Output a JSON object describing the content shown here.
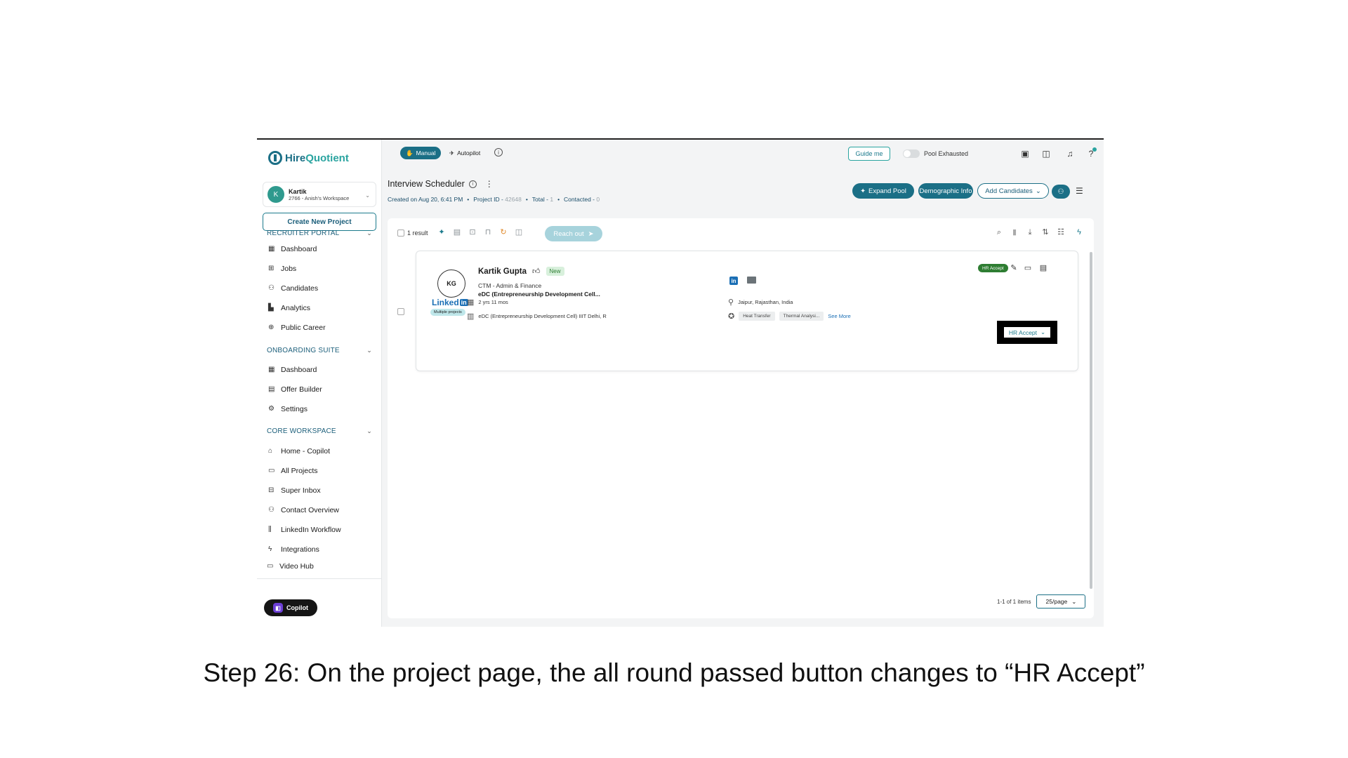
{
  "caption": "Step 26:  On the project page, the all round passed button changes to “HR Accept”",
  "brand": {
    "name_a": "Hire",
    "name_b": "Quotient"
  },
  "user": {
    "initial": "K",
    "name": "Kartik",
    "workspace": "2766 - Anish's Workspace"
  },
  "sidebar": {
    "create_label": "Create New Project",
    "sections": [
      {
        "title": "RECRUITER PORTAL",
        "items": [
          "Dashboard",
          "Jobs",
          "Candidates",
          "Analytics",
          "Public Career"
        ]
      },
      {
        "title": "ONBOARDING SUITE",
        "items": [
          "Dashboard",
          "Offer Builder",
          "Settings"
        ]
      },
      {
        "title": "CORE WORKSPACE",
        "items": [
          "Home - Copilot",
          "All Projects",
          "Super Inbox",
          "Contact Overview",
          "LinkedIn Workflow",
          "Integrations"
        ]
      }
    ],
    "video_hub": "Video Hub",
    "copilot": "Copilot"
  },
  "topbar": {
    "manual": "Manual",
    "autopilot": "Autopilot",
    "guide": "Guide me",
    "pool_label": "Pool Exhausted",
    "avatar": "K"
  },
  "project": {
    "title": "Interview Scheduler",
    "created_prefix": "Created on",
    "created_value": "Aug 20, 6:41 PM",
    "project_id_label": "Project ID -",
    "project_id_value": "42648",
    "total_label": "Total -",
    "total_value": "1",
    "contacted_label": "Contacted -",
    "contacted_value": "0",
    "expand_pool": "Expand Pool",
    "demographic": "Demographic Info",
    "add_candidates": "Add Candidates"
  },
  "toolbar": {
    "result_label": "1 result",
    "reach_out": "Reach out"
  },
  "candidate": {
    "initials": "KG",
    "name": "Kartik Gupta",
    "status_badge": "New",
    "role": "CTM - Admin & Finance",
    "org": "eDC (Entrepreneurship Development Cell...",
    "linkedin_text": "Linked",
    "linkedin_in": "in",
    "multi_projects": "Multiple projects",
    "experience": "2 yrs 11 mos",
    "education": "eDC (Entrepreneurship Development Cell) IIIT Delhi, R",
    "location": "Jaipur, Rajasthan, India",
    "skills": [
      "Heat Transfer",
      "Thermal Analysi..."
    ],
    "see_more": "See More",
    "stage_badge": "HR Accept",
    "stage_select": "HR Accept"
  },
  "pagination": {
    "range": "1-1 of 1 items",
    "per_page": "25/page"
  },
  "colors": {
    "primary": "#1b6f86",
    "accent": "#2aa4a0",
    "success": "#2e7d32"
  }
}
